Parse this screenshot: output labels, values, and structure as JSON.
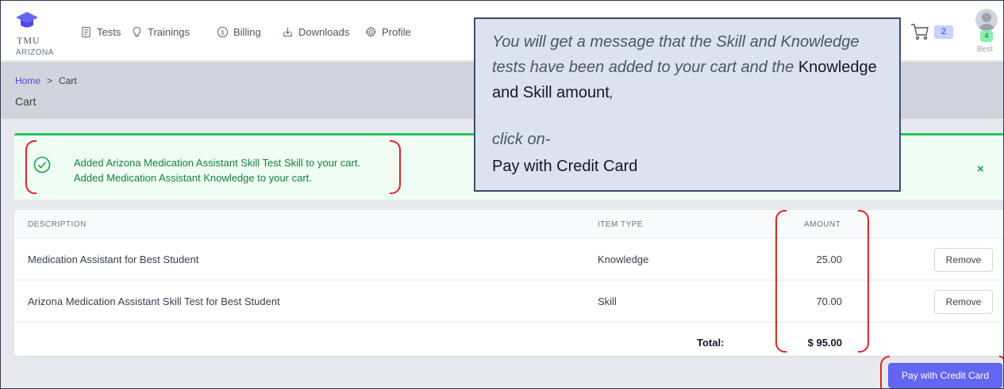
{
  "brand": {
    "line1": "TMU",
    "line2": "ARIZONA"
  },
  "nav": {
    "items": [
      {
        "label": "Tests",
        "icon": "document-icon"
      },
      {
        "label": "Trainings",
        "icon": "lightbulb-icon"
      },
      {
        "label": "Billing",
        "icon": "dollar-circle-icon"
      },
      {
        "label": "Downloads",
        "icon": "download-icon"
      },
      {
        "label": "Profile",
        "icon": "gear-icon"
      }
    ],
    "cart_count": "2",
    "user_badge": "4",
    "user_name": "Best"
  },
  "breadcrumb": {
    "home": "Home",
    "separator": ">",
    "current": "Cart"
  },
  "page_title": "Cart",
  "alert": {
    "line1": "Added Arizona Medication Assistant Skill Test Skill to your cart.",
    "line2": "Added Medication Assistant Knowledge to your cart.",
    "close": "×"
  },
  "table": {
    "headers": {
      "description": "DESCRIPTION",
      "item_type": "ITEM TYPE",
      "amount": "AMOUNT"
    },
    "rows": [
      {
        "description": "Medication Assistant for Best Student",
        "item_type": "Knowledge",
        "amount": "25.00",
        "action": "Remove"
      },
      {
        "description": "Arizona Medication Assistant Skill Test for Best Student",
        "item_type": "Skill",
        "amount": "70.00",
        "action": "Remove"
      }
    ],
    "total_label": "Total:",
    "total_value": "$ 95.00"
  },
  "pay_button": "Pay with Credit Card",
  "callout": {
    "intro": "You will get a message that the Skill and Knowledge tests have been added to your cart and the",
    "highlight": "Knowledge and Skill amount",
    "comma": ",",
    "click": "click on-",
    "action": "Pay with Credit Card"
  },
  "colors": {
    "accent": "#6366f1",
    "success": "#22c55e",
    "annotation_red": "#dc2626",
    "callout_bg": "#dbe3f1"
  }
}
